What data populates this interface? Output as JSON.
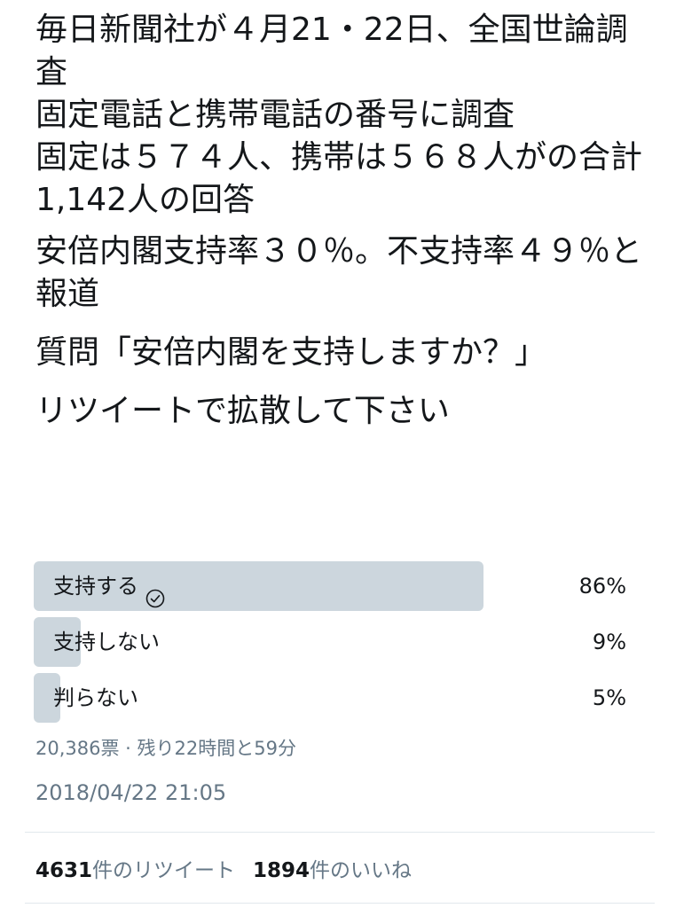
{
  "tweet": {
    "paragraphs": [
      "毎日新聞社が４月21・22日、全国世論調査",
      "固定電話と携帯電話の番号に調査",
      "固定は５７４人、携帯は５６８人がの合計1,142人の回答",
      "安倍内閣支持率３０％。不支持率４９％と報道",
      "質問「安倍内閣を支持しますか？」",
      "リツイートで拡散して下さい"
    ]
  },
  "poll": {
    "options": [
      {
        "label": "支持する",
        "percent_label": "86%",
        "percent": 86,
        "selected": true
      },
      {
        "label": "支持しない",
        "percent_label": "9%",
        "percent": 9,
        "selected": false
      },
      {
        "label": "判らない",
        "percent_label": "5%",
        "percent": 5,
        "selected": false
      }
    ],
    "meta": "20,386票 · 残り22時間と59分",
    "bar_color": "#ccd6dd"
  },
  "timestamp": "2018/04/22 21:05",
  "stats": {
    "retweets_count": "4631",
    "retweets_label": "件のリツイート",
    "likes_count": "1894",
    "likes_label": "件のいいね"
  },
  "icons": {
    "selected_check": "check-circle-icon"
  }
}
